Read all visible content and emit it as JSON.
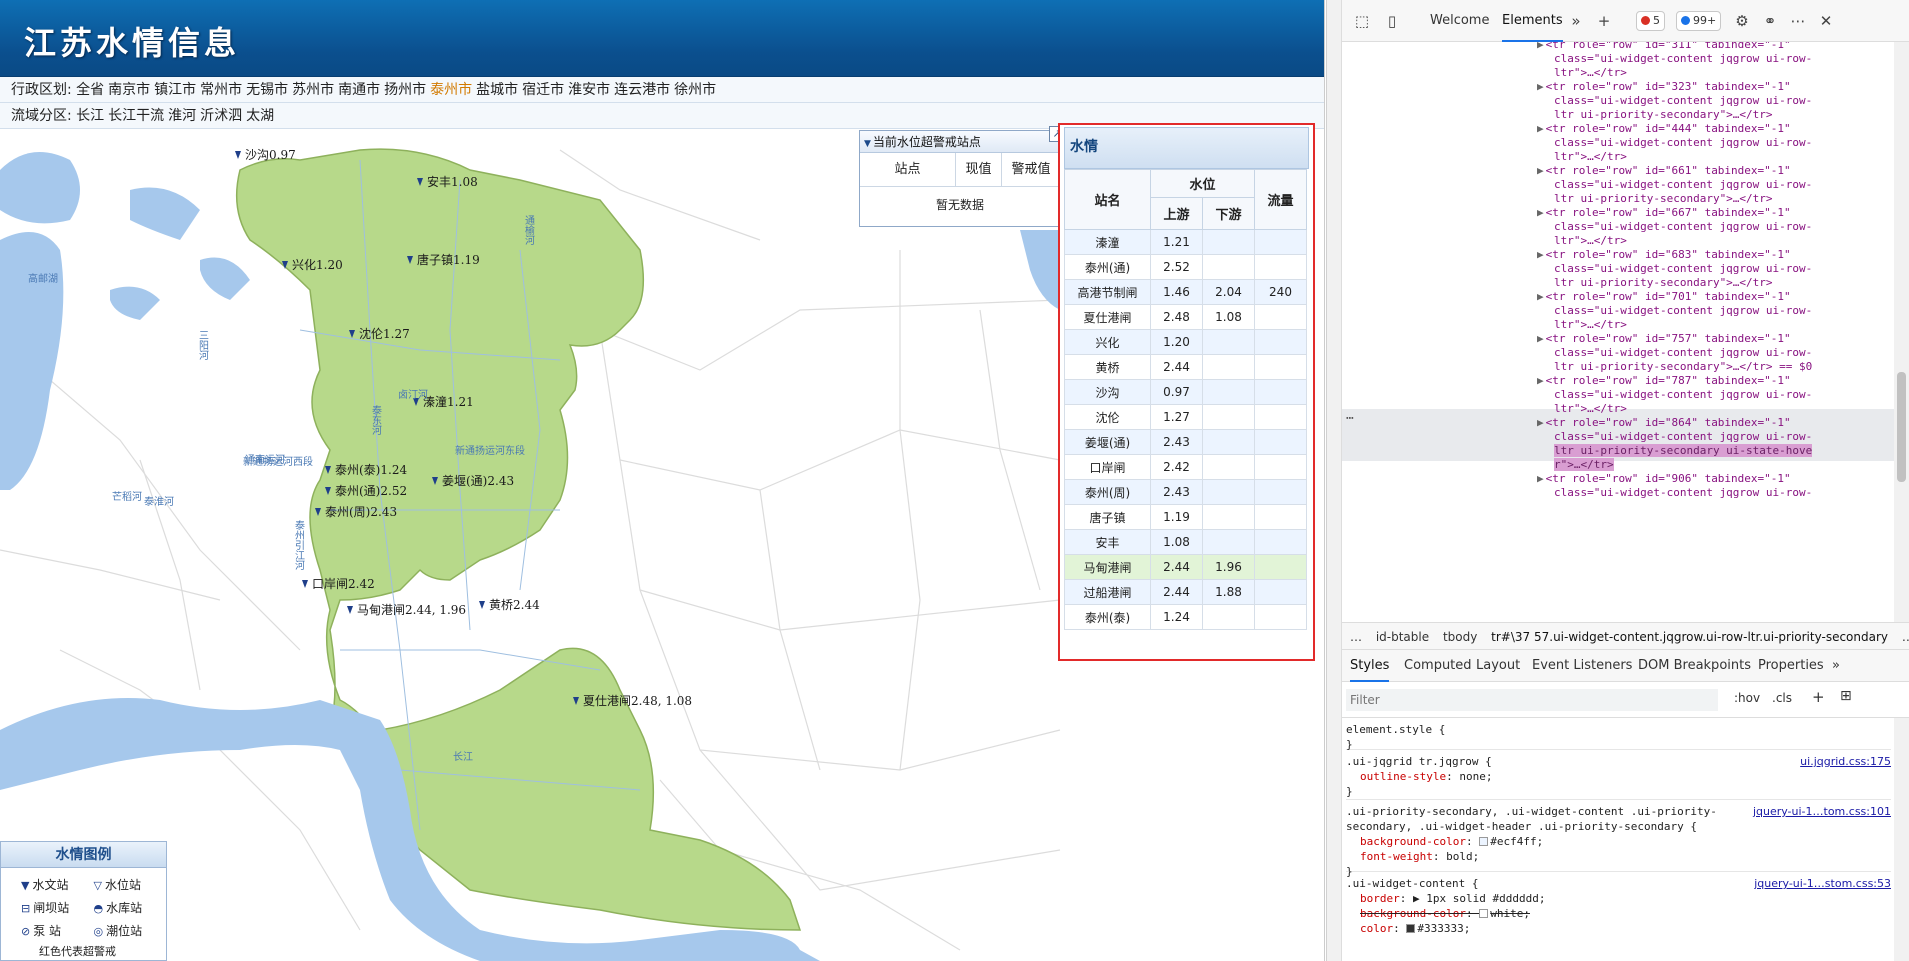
{
  "site": {
    "title": "江苏水情信息"
  },
  "filters": {
    "admin_label": "行政区划:",
    "admin_options": [
      "全省",
      "南京市",
      "镇江市",
      "常州市",
      "无锡市",
      "苏州市",
      "南通市",
      "扬州市",
      "泰州市",
      "盐城市",
      "宿迁市",
      "淮安市",
      "连云港市",
      "徐州市"
    ],
    "admin_active": "泰州市",
    "basin_label": "流域分区:",
    "basin_options": [
      "长江",
      "长江干流",
      "淮河",
      "沂沭泗",
      "太湖"
    ]
  },
  "map": {
    "stations": [
      {
        "label": "沙沟0.97"
      },
      {
        "label": "安丰1.08"
      },
      {
        "label": "兴化1.20"
      },
      {
        "label": "唐子镇1.19"
      },
      {
        "label": "沈伦1.27"
      },
      {
        "label": "溱潼1.21"
      },
      {
        "label": "泰州(泰)1.24"
      },
      {
        "label": "泰州(通)2.52"
      },
      {
        "label": "姜堰(通)2.43"
      },
      {
        "label": "泰州(周)2.43"
      },
      {
        "label": "口岸闸2.42"
      },
      {
        "label": "马甸港闸2.44, 1.96"
      },
      {
        "label": "黄桥2.44"
      },
      {
        "label": "夏仕港闸2.48, 1.08"
      }
    ],
    "rivers": [
      "通榆河",
      "三阳河",
      "高邮湖",
      "泰东河",
      "通南运河",
      "新通扬运河东段",
      "新通扬运河西段",
      "泰州引江河",
      "芒稻河",
      "长江",
      "卤汀河",
      "泰淮河"
    ],
    "colors": {
      "land": "#b7d98a",
      "water": "#a6c8ec",
      "road": "#d9d9d9"
    }
  },
  "alert_panel": {
    "title": "当前水位超警戒站点",
    "columns": [
      "站点",
      "现值",
      "警戒值"
    ],
    "empty": "暂无数据"
  },
  "water_panel": {
    "title": "水情",
    "col_station": "站名",
    "col_level": "水位",
    "col_up": "上游",
    "col_down": "下游",
    "col_flow": "流量",
    "rows": [
      {
        "station": "溱潼",
        "up": "1.21",
        "down": "",
        "flow": ""
      },
      {
        "station": "泰州(通)",
        "up": "2.52",
        "down": "",
        "flow": ""
      },
      {
        "station": "高港节制闸",
        "up": "1.46",
        "down": "2.04",
        "flow": "240"
      },
      {
        "station": "夏仕港闸",
        "up": "2.48",
        "down": "1.08",
        "flow": ""
      },
      {
        "station": "兴化",
        "up": "1.20",
        "down": "",
        "flow": ""
      },
      {
        "station": "黄桥",
        "up": "2.44",
        "down": "",
        "flow": ""
      },
      {
        "station": "沙沟",
        "up": "0.97",
        "down": "",
        "flow": ""
      },
      {
        "station": "沈伦",
        "up": "1.27",
        "down": "",
        "flow": ""
      },
      {
        "station": "姜堰(通)",
        "up": "2.43",
        "down": "",
        "flow": ""
      },
      {
        "station": "口岸闸",
        "up": "2.42",
        "down": "",
        "flow": ""
      },
      {
        "station": "泰州(周)",
        "up": "2.43",
        "down": "",
        "flow": ""
      },
      {
        "station": "唐子镇",
        "up": "1.19",
        "down": "",
        "flow": ""
      },
      {
        "station": "安丰",
        "up": "1.08",
        "down": "",
        "flow": ""
      },
      {
        "station": "马甸港闸",
        "up": "2.44",
        "down": "1.96",
        "flow": ""
      },
      {
        "station": "过船港闸",
        "up": "2.44",
        "down": "1.88",
        "flow": ""
      },
      {
        "station": "泰州(泰)",
        "up": "1.24",
        "down": "",
        "flow": ""
      }
    ]
  },
  "legend": {
    "title": "水情图例",
    "items": [
      "水文站",
      "水位站",
      "闸坝站",
      "水库站",
      "泵 站",
      "潮位站"
    ],
    "footer": "红色代表超警戒"
  },
  "devtools": {
    "tabs": [
      "Welcome",
      "Elements"
    ],
    "errors": "5",
    "issues": "99+",
    "dom_lines": [
      "<tr role=\"row\" id=\"311\" tabindex=\"-1\"",
      "class=\"ui-widget-content jqgrow ui-row-",
      "ltr\">…</tr>",
      "<tr role=\"row\" id=\"323\" tabindex=\"-1\"",
      "class=\"ui-widget-content jqgrow ui-row-",
      "ltr ui-priority-secondary\">…</tr>",
      "<tr role=\"row\" id=\"444\" tabindex=\"-1\"",
      "class=\"ui-widget-content jqgrow ui-row-",
      "ltr\">…</tr>",
      "<tr role=\"row\" id=\"661\" tabindex=\"-1\"",
      "class=\"ui-widget-content jqgrow ui-row-",
      "ltr ui-priority-secondary\">…</tr>",
      "<tr role=\"row\" id=\"667\" tabindex=\"-1\"",
      "class=\"ui-widget-content jqgrow ui-row-",
      "ltr\">…</tr>",
      "<tr role=\"row\" id=\"683\" tabindex=\"-1\"",
      "class=\"ui-widget-content jqgrow ui-row-",
      "ltr ui-priority-secondary\">…</tr>",
      "<tr role=\"row\" id=\"701\" tabindex=\"-1\"",
      "class=\"ui-widget-content jqgrow ui-row-",
      "ltr\">…</tr>",
      "<tr role=\"row\" id=\"757\" tabindex=\"-1\"",
      "class=\"ui-widget-content jqgrow ui-row-",
      "ltr ui-priority-secondary\">…</tr> == $0",
      "<tr role=\"row\" id=\"787\" tabindex=\"-1\"",
      "class=\"ui-widget-content jqgrow ui-row-",
      "ltr\">…</tr>",
      "<tr role=\"row\" id=\"864\" tabindex=\"-1\"",
      "class=\"ui-widget-content jqgrow ui-row-",
      "ltr ui-priority-secondary ui-state-hove",
      "r\">…</tr>",
      "<tr role=\"row\" id=\"906\" tabindex=\"-1\"",
      "class=\"ui-widget-content jqgrow ui-row-"
    ],
    "breadcrumbs": [
      "…",
      "id-btable",
      "tbody",
      "tr#\\37 57.ui-widget-content.jqgrow.ui-row-ltr.ui-priority-secondary",
      "…"
    ],
    "subtabs": [
      "Styles",
      "Computed",
      "Layout",
      "Event Listeners",
      "DOM Breakpoints",
      "Properties"
    ],
    "filter_placeholder": "Filter",
    "hov": ":hov",
    "cls": ".cls",
    "rules": [
      {
        "selector": "element.style {",
        "props": [],
        "source": ""
      },
      {
        "selector": ".ui-jqgrid tr.jqgrow {",
        "props": [
          [
            "outline-style",
            "none;"
          ]
        ],
        "source": "ui.jqgrid.css:175"
      },
      {
        "selector": ".ui-priority-secondary, .ui-widget-content .ui-priority-secondary, .ui-widget-header .ui-priority-secondary {",
        "props": [
          [
            "background-color",
            "#ecf4ff;"
          ],
          [
            "font-weight",
            "bold;"
          ]
        ],
        "source": "jquery-ui-1…tom.css:101"
      },
      {
        "selector": ".ui-widget-content {",
        "props": [
          [
            "border",
            "▶ 1px solid #dddddd;"
          ],
          [
            "background-color",
            "white;"
          ],
          [
            "color",
            "#333333;"
          ]
        ],
        "source": "jquery-ui-1…stom.css:53"
      }
    ]
  }
}
